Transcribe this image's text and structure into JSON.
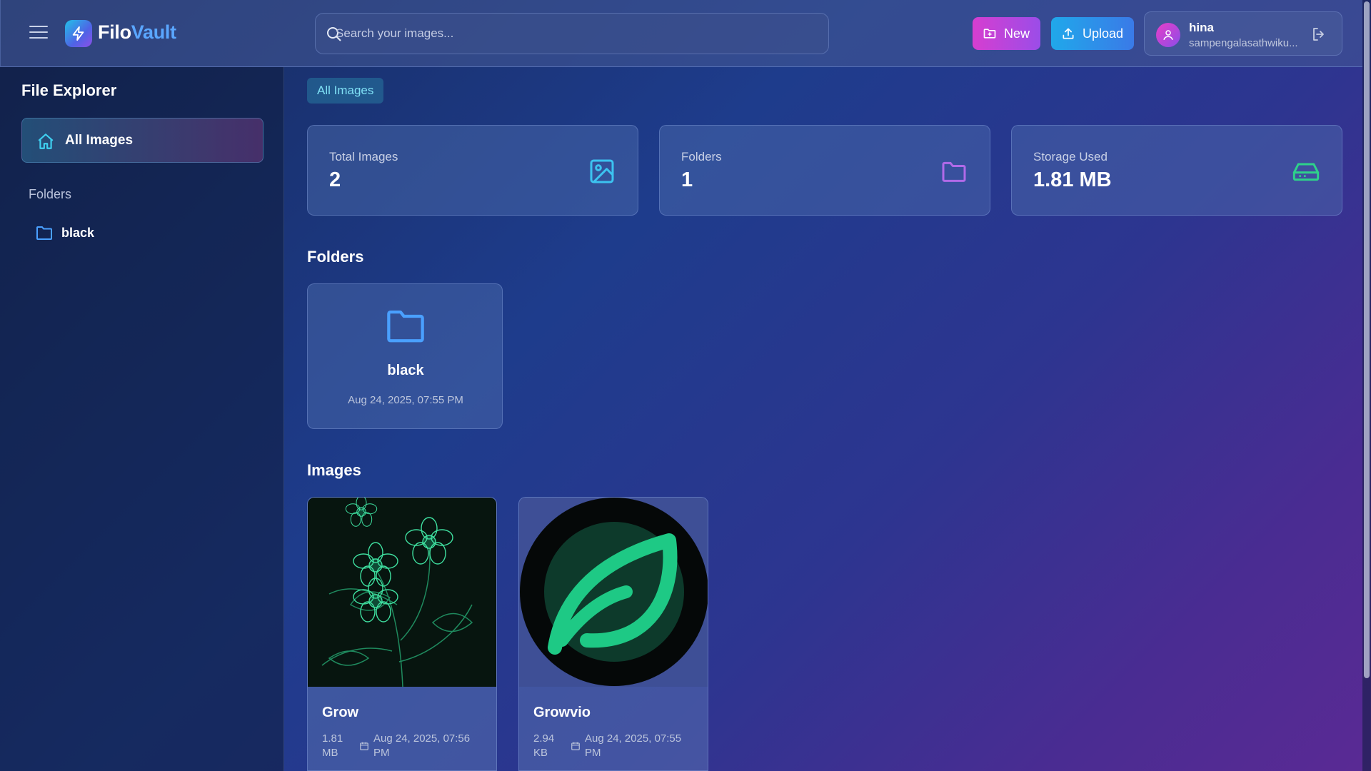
{
  "app": {
    "name_part1": "Filo",
    "name_part2": "Vault",
    "accent": "#5aa6ff"
  },
  "header": {
    "search_placeholder": "Search your images...",
    "new_label": "New",
    "upload_label": "Upload",
    "user_name": "hina",
    "user_email": "sampengalasathwiku..."
  },
  "sidebar": {
    "title": "File Explorer",
    "all_images_label": "All Images",
    "folders_label": "Folders",
    "folders": [
      {
        "name": "black"
      }
    ]
  },
  "breadcrumb": {
    "label": "All Images"
  },
  "stats": [
    {
      "label": "Total Images",
      "value": "2",
      "icon": "image-icon",
      "color": "#3cc3f0"
    },
    {
      "label": "Folders",
      "value": "1",
      "icon": "folder-icon",
      "color": "#b06ae8"
    },
    {
      "label": "Storage Used",
      "value": "1.81 MB",
      "icon": "hard-drive-icon",
      "color": "#2ed18a"
    }
  ],
  "sections": {
    "folders_title": "Folders",
    "images_title": "Images"
  },
  "folder_cards": [
    {
      "name": "black",
      "date": "Aug 24, 2025, 07:55 PM"
    }
  ],
  "images": [
    {
      "name": "Grow",
      "size": "1.81 MB",
      "date": "Aug 24, 2025, 07:56 PM"
    },
    {
      "name": "Growvio",
      "size": "2.94 KB",
      "date": "Aug 24, 2025, 07:55 PM"
    }
  ]
}
